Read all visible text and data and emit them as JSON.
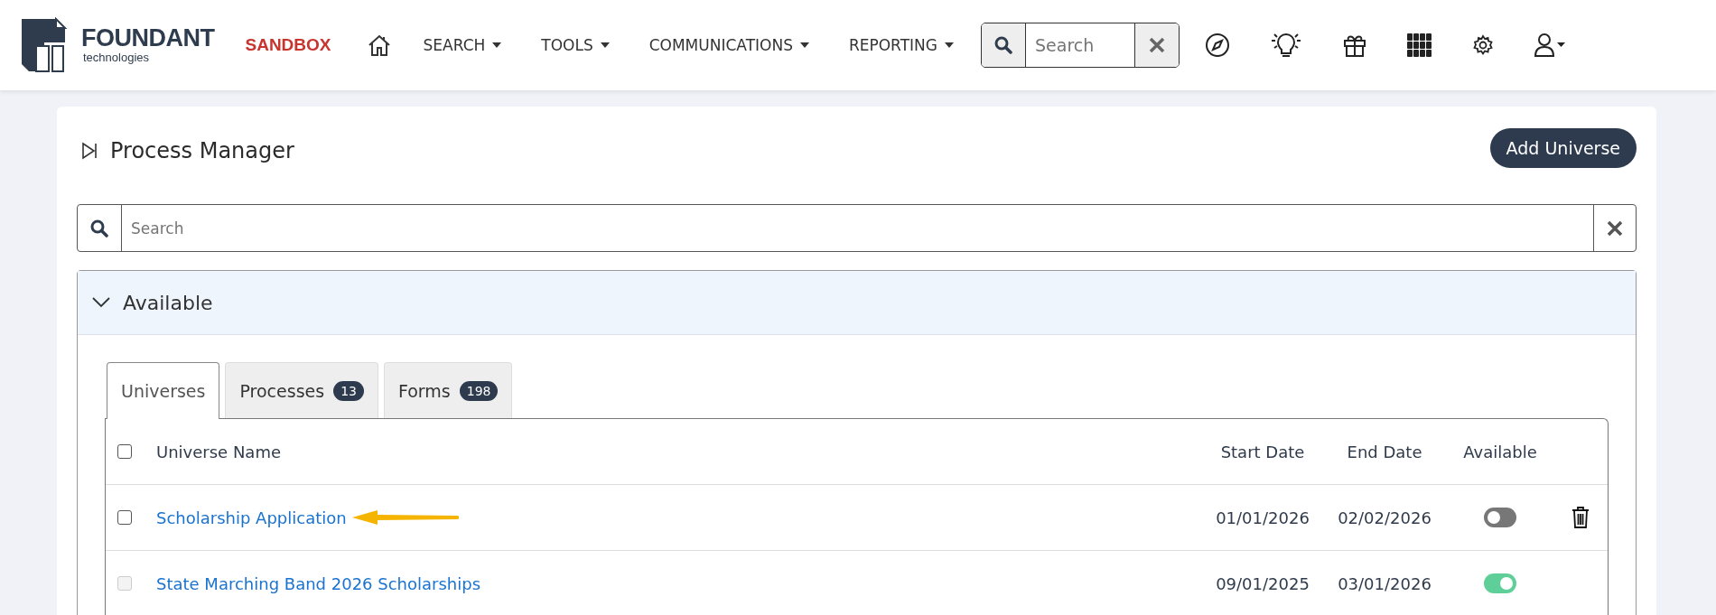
{
  "header": {
    "logo": {
      "name": "FOUNDANT",
      "sub": "technologies"
    },
    "env": "SANDBOX",
    "nav": [
      {
        "label": "SEARCH",
        "dropdown": true
      },
      {
        "label": "TOOLS",
        "dropdown": true
      },
      {
        "label": "COMMUNICATIONS",
        "dropdown": true
      },
      {
        "label": "REPORTING",
        "dropdown": true
      }
    ],
    "search": {
      "placeholder": "Search"
    }
  },
  "page": {
    "title": "Process Manager",
    "add_button": "Add Universe",
    "search": {
      "placeholder": "Search"
    },
    "panel": {
      "title": "Available",
      "expanded": true,
      "tabs": [
        {
          "label": "Universes",
          "selected": true
        },
        {
          "label": "Processes",
          "count": "13",
          "selected": false
        },
        {
          "label": "Forms",
          "count": "198",
          "selected": false
        }
      ],
      "table": {
        "columns": [
          "Universe Name",
          "Start Date",
          "End Date",
          "Available"
        ],
        "header_checked": false,
        "rows": [
          {
            "name": "Scholarship Application",
            "start": "01/01/2026",
            "end": "02/02/2026",
            "available": false,
            "checked": false,
            "disabled": false,
            "deletable": true,
            "pointer": true
          },
          {
            "name": "State Marching Band 2026 Scholarships",
            "start": "09/01/2025",
            "end": "03/01/2026",
            "available": true,
            "checked": false,
            "disabled": true,
            "deletable": false,
            "pointer": false
          }
        ]
      }
    }
  }
}
